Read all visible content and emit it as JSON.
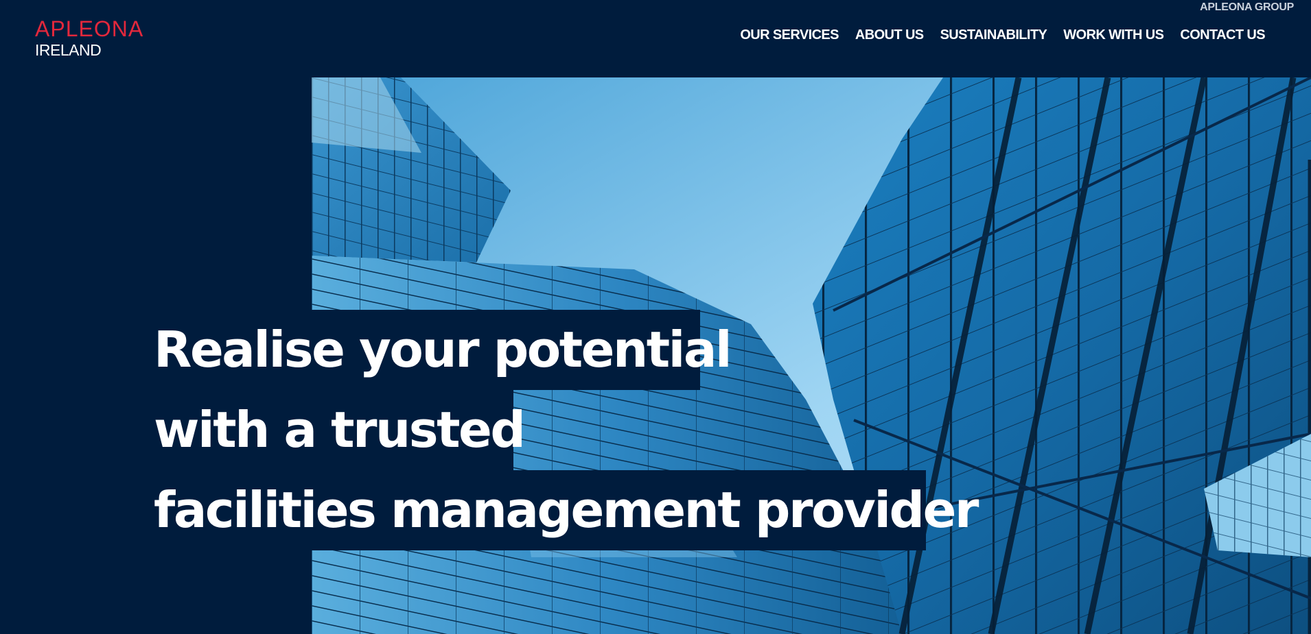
{
  "header": {
    "group_link": "APLEONA GROUP",
    "logo": {
      "brand": "APLEONA",
      "region": "IRELAND"
    },
    "nav": [
      {
        "label": "OUR SERVICES"
      },
      {
        "label": "ABOUT US"
      },
      {
        "label": "SUSTAINABILITY"
      },
      {
        "label": "WORK WITH US"
      },
      {
        "label": "CONTACT US"
      }
    ]
  },
  "hero": {
    "headline_lines": [
      "Realise your potential",
      "with a trusted",
      "facilities management provider"
    ],
    "image_subject": "glass-skyscrapers-photo"
  },
  "colors": {
    "background": "#001c3d",
    "brand_red": "#e3283c",
    "text": "#ffffff",
    "sky": "#6fb7e6"
  }
}
